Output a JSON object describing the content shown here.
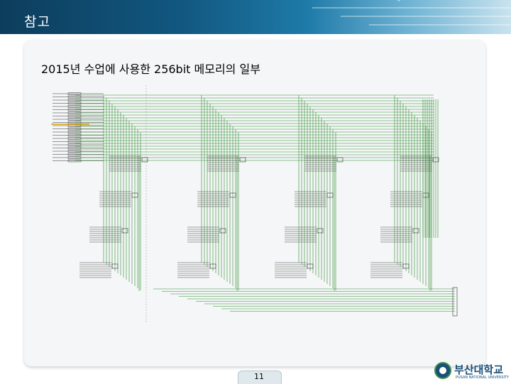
{
  "slide": {
    "title": "참고",
    "subtitle": "2015년 수업에 사용한 256bit 메모리의 일부",
    "page_number": "11"
  },
  "logo": {
    "name": "부산대학교",
    "subtitle": "PUSAN NATIONAL UNIVERSITY"
  },
  "colors": {
    "header": "#11577f",
    "wire": "#2e8b2e",
    "panel": "#f4f6f7"
  }
}
